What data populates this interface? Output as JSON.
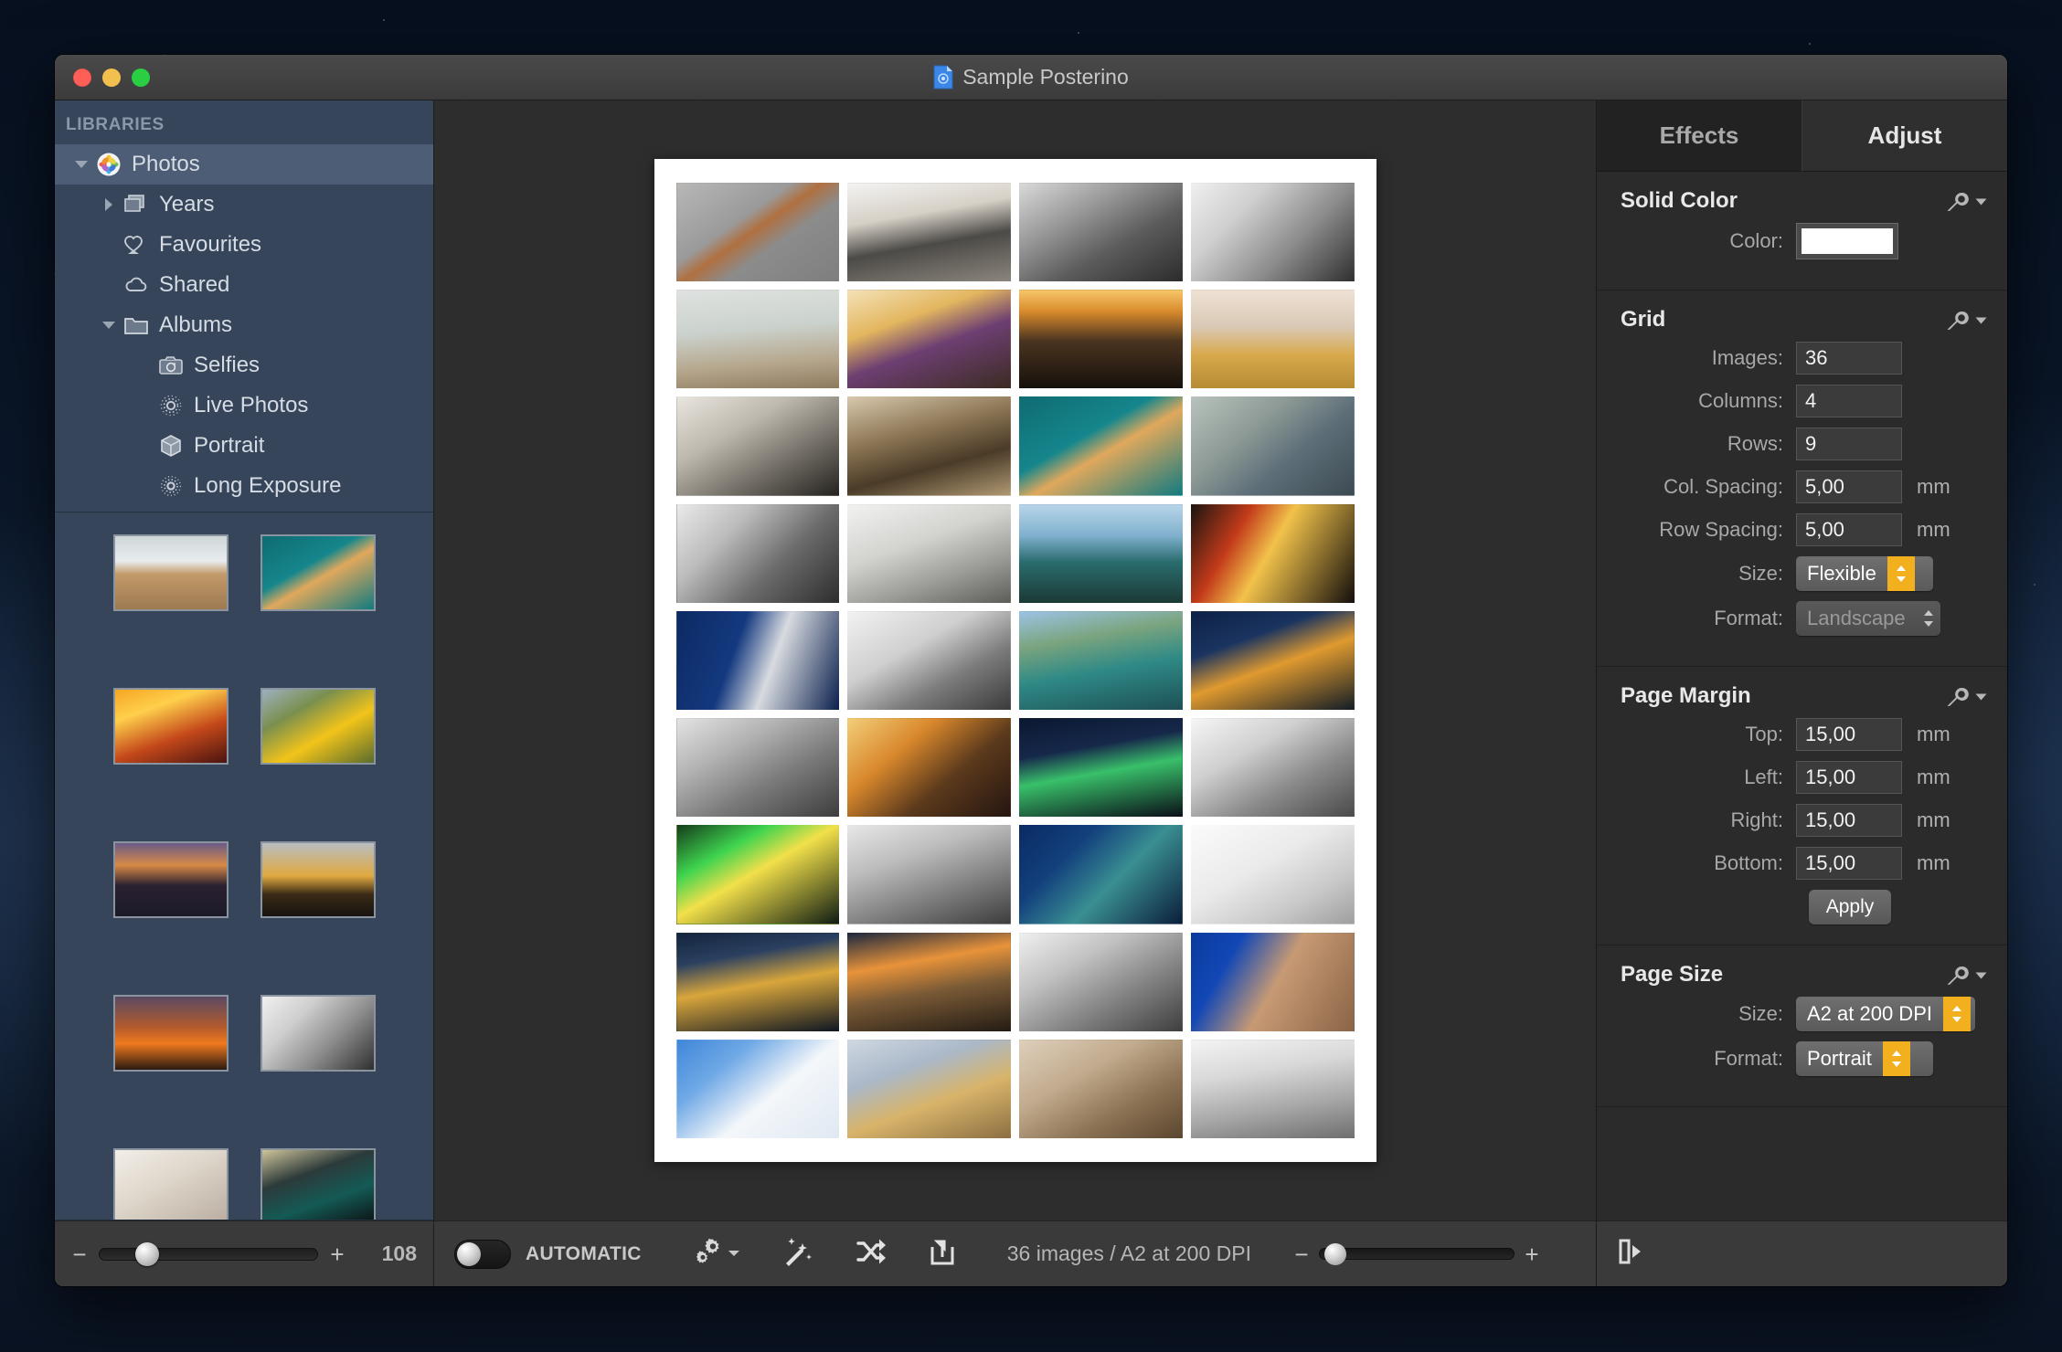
{
  "window": {
    "title": "Sample Posterino",
    "traffic_lights": [
      "close-button",
      "minimize-button",
      "zoom-button"
    ]
  },
  "sidebar": {
    "header": "LIBRARIES",
    "tree": [
      {
        "label": "Photos",
        "icon": "photos-app-icon",
        "depth": 0,
        "twisty": "down",
        "selected": true
      },
      {
        "label": "Years",
        "icon": "stack-icon",
        "depth": 1,
        "twisty": "right",
        "selected": false
      },
      {
        "label": "Favourites",
        "icon": "heart-icon",
        "depth": 1,
        "twisty": "none",
        "selected": false
      },
      {
        "label": "Shared",
        "icon": "cloud-icon",
        "depth": 1,
        "twisty": "none",
        "selected": false
      },
      {
        "label": "Albums",
        "icon": "folder-icon",
        "depth": 1,
        "twisty": "down",
        "selected": false
      },
      {
        "label": "Selfies",
        "icon": "camera-icon",
        "depth": 2,
        "twisty": "none",
        "selected": false
      },
      {
        "label": "Live Photos",
        "icon": "live-photo-icon",
        "depth": 2,
        "twisty": "none",
        "selected": false
      },
      {
        "label": "Portrait",
        "icon": "cube-icon",
        "depth": 2,
        "twisty": "none",
        "selected": false
      },
      {
        "label": "Long Exposure",
        "icon": "long-exposure-icon",
        "depth": 2,
        "twisty": "none",
        "selected": false
      }
    ],
    "browser_thumbnails": [
      "beach-driftwood",
      "wooden-boat-teal-water",
      "honey-jars",
      "sunflower-field",
      "river-sunset-skyline",
      "church-spire-sunset-trees",
      "orange-sunset-treeline",
      "foggy-riverside-bw",
      "folded-hands-sculpture",
      "subway-train-station"
    ],
    "footer": {
      "minus": "−",
      "plus": "+",
      "slider_value_percent": 22,
      "count": "108"
    }
  },
  "canvas": {
    "page": {
      "columns": 4,
      "rows": 9,
      "images": [
        "survey-marker-bw",
        "pier-pavilion-bw",
        "golden-gate-underside-bw",
        "foggy-riverside-bw",
        "dog-beach-bridge",
        "blueberry-cheesecake",
        "sunset-over-bay",
        "wheat-field-spire",
        "pantheon-dome-bw",
        "pier-pilings-sepia",
        "wooden-boat-teal-water",
        "padlock-fence",
        "fire-escape-facade-bw",
        "stone-face-relief-bw",
        "coastal-cliff-sea",
        "light-trails-street",
        "transamerica-pyramid",
        "moka-pot-stove-bw",
        "golden-gate-bay-view",
        "museum-dusk-lights",
        "bridge-chain-bw",
        "sun-flare-buildings",
        "night-street-trails-tower",
        "fountain-park-bw",
        "carousel-night-lights",
        "bridge-rivets-bw",
        "glass-facade-dusk",
        "white-staircase-bw",
        "city-street-dusk-lights",
        "curved-roof-plaza-dusk",
        "hillside-houses-bw",
        "brick-rotunda-building",
        "sailboat-ger-370",
        "bee-on-blossoms",
        "zeus-statue-sculpture",
        "foggy-city-skyline-bw"
      ]
    }
  },
  "bottombar": {
    "automatic_label": "AUTOMATIC",
    "automatic_on": false,
    "tools": [
      {
        "name": "settings-gear-icon",
        "has_dropdown": true
      },
      {
        "name": "magic-wand-icon",
        "has_dropdown": false
      },
      {
        "name": "shuffle-icon",
        "has_dropdown": false
      },
      {
        "name": "export-share-icon",
        "has_dropdown": false
      }
    ],
    "status": "36 images / A2 at 200 DPI",
    "zoom": {
      "minus": "−",
      "plus": "+",
      "value_percent": 8
    }
  },
  "inspector": {
    "tabs": [
      {
        "label": "Effects",
        "active": false
      },
      {
        "label": "Adjust",
        "active": true
      }
    ],
    "sections": [
      {
        "title": "Solid Color",
        "wrench": "wrench-icon",
        "fields": [
          {
            "label": "Color:",
            "type": "color",
            "value": "#ffffff"
          }
        ]
      },
      {
        "title": "Grid",
        "wrench": "wrench-icon",
        "fields": [
          {
            "label": "Images:",
            "type": "text",
            "value": "36"
          },
          {
            "label": "Columns:",
            "type": "text",
            "value": "4"
          },
          {
            "label": "Rows:",
            "type": "text",
            "value": "9"
          },
          {
            "label": "Col. Spacing:",
            "type": "text",
            "value": "5,00",
            "unit": "mm"
          },
          {
            "label": "Row Spacing:",
            "type": "text",
            "value": "5,00",
            "unit": "mm"
          },
          {
            "label": "Size:",
            "type": "popup",
            "value": "Flexible",
            "enabled": true
          },
          {
            "label": "Format:",
            "type": "popup",
            "value": "Landscape",
            "enabled": false
          }
        ]
      },
      {
        "title": "Page Margin",
        "wrench": "wrench-icon",
        "fields": [
          {
            "label": "Top:",
            "type": "text",
            "value": "15,00",
            "unit": "mm"
          },
          {
            "label": "Left:",
            "type": "text",
            "value": "15,00",
            "unit": "mm"
          },
          {
            "label": "Right:",
            "type": "text",
            "value": "15,00",
            "unit": "mm"
          },
          {
            "label": "Bottom:",
            "type": "text",
            "value": "15,00",
            "unit": "mm"
          }
        ],
        "apply_label": "Apply"
      },
      {
        "title": "Page Size",
        "wrench": "wrench-icon",
        "fields": [
          {
            "label": "Size:",
            "type": "popup",
            "value": "A2 at 200 DPI",
            "enabled": true
          },
          {
            "label": "Format:",
            "type": "popup",
            "value": "Portrait",
            "enabled": true
          }
        ]
      }
    ],
    "footer_icon": "open-panel-icon"
  },
  "colors": {
    "accent_yellow": "#f2b01e",
    "sidebar_bg": "#36455a",
    "sidebar_selected": "#4c5d75",
    "inspector_bg": "#2b2b2b",
    "canvas_bg": "#2d2d2d",
    "page_bg": "#ffffff"
  }
}
